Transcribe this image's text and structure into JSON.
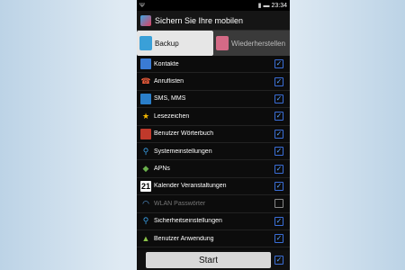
{
  "status": {
    "time": "23:34",
    "battery_text": "",
    "icons": [
      "usb-icon",
      "signal-icon",
      "battery-icon"
    ]
  },
  "header": {
    "title": "Sichern Sie Ihre mobilen"
  },
  "tabs": [
    {
      "label": "Backup",
      "active": true
    },
    {
      "label": "Wiederherstellen",
      "active": false
    }
  ],
  "items": [
    {
      "label": "Kontakte",
      "checked": true,
      "enabled": true,
      "icon": "contacts-icon"
    },
    {
      "label": "Anruflisten",
      "checked": true,
      "enabled": true,
      "icon": "call-log-icon"
    },
    {
      "label": "SMS, MMS",
      "checked": true,
      "enabled": true,
      "icon": "sms-icon"
    },
    {
      "label": "Lesezeichen",
      "checked": true,
      "enabled": true,
      "icon": "bookmark-star-icon"
    },
    {
      "label": "Benutzer Wörterbuch",
      "checked": true,
      "enabled": true,
      "icon": "dictionary-icon"
    },
    {
      "label": "Systemeinstellungen",
      "checked": true,
      "enabled": true,
      "icon": "system-settings-icon"
    },
    {
      "label": "APNs",
      "checked": true,
      "enabled": true,
      "icon": "apn-icon"
    },
    {
      "label": "Kalender Veranstaltungen",
      "checked": true,
      "enabled": true,
      "icon": "calendar-icon"
    },
    {
      "label": "WLAN Passwörter",
      "checked": false,
      "enabled": false,
      "icon": "wifi-icon"
    },
    {
      "label": "Sicherheitseinstellungen",
      "checked": true,
      "enabled": true,
      "icon": "security-settings-icon"
    },
    {
      "label": "Benutzer Anwendung",
      "checked": true,
      "enabled": true,
      "icon": "android-icon"
    }
  ],
  "calendar_day": "21",
  "footer": {
    "start_label": "Start",
    "select_all_checked": true
  }
}
